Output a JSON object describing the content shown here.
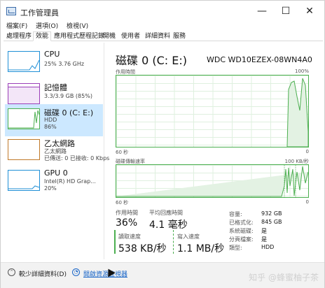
{
  "window": {
    "title": "工作管理員",
    "minimize": "—",
    "maximize": "☐",
    "close": "✕"
  },
  "menu": [
    "檔案(F)",
    "選項(O)",
    "檢視(V)"
  ],
  "tabs": [
    "處理程序",
    "效能",
    "應用程式歷程記錄",
    "開機",
    "使用者",
    "詳細資料",
    "服務"
  ],
  "active_tab": "效能",
  "sidebar": {
    "items": [
      {
        "name": "CPU",
        "sub1": "25%  3.76 GHz",
        "sub2": "",
        "sub3": "",
        "color": "#1f8fd6"
      },
      {
        "name": "記憶體",
        "sub1": "3.3/3.9 GB (85%)",
        "sub2": "",
        "sub3": "",
        "color": "#9b3fb8"
      },
      {
        "name": "磁碟 0 (C: E:)",
        "sub1": "HDD",
        "sub2": "86%",
        "sub3": "",
        "color": "#4caf50"
      },
      {
        "name": "乙太網路",
        "sub1": "乙太網路",
        "sub2": "已傳送: 0 已接收: 0 Kbps",
        "sub3": "",
        "color": "#c07a2a"
      },
      {
        "name": "GPU 0",
        "sub1": "Intel(R) HD Grap...",
        "sub2": "20%",
        "sub3": "",
        "color": "#1f8fd6"
      }
    ]
  },
  "main": {
    "title": "磁碟 0 (C: E:)",
    "model": "WDC WD10EZEX-08WN4A0",
    "graph1": {
      "label": "作用時間",
      "max": "100%",
      "x_left": "60 秒",
      "x_right": "0"
    },
    "graph2": {
      "label": "磁碟傳輸速率",
      "max": "100 KB/秒",
      "x_left": "60 秒",
      "x_right": "0"
    },
    "stats": {
      "active_time_label": "作用時間",
      "active_time_value": "36%",
      "response_label": "平均回應時間",
      "response_value": "4.1 毫秒",
      "read_label": "讀取速度",
      "read_value": "538 KB/秒",
      "write_label": "寫入速度",
      "write_value": "1.1 MB/秒"
    },
    "props": [
      {
        "key": "容量:",
        "value": "932 GB"
      },
      {
        "key": "已格式化:",
        "value": "845 GB"
      },
      {
        "key": "系統磁碟:",
        "value": "是"
      },
      {
        "key": "分頁檔案:",
        "value": "是"
      },
      {
        "key": "類型:",
        "value": "HDD"
      }
    ]
  },
  "footer": {
    "fewer_details": "較少詳細資料(D)",
    "open_monitor": "開啟資源監視器"
  },
  "watermark": "知乎 @蜂蜜柚子茶",
  "colors": {
    "disk_green": "#4caf50",
    "selected_bg": "#cce8ff",
    "link_blue": "#1a66c8"
  }
}
